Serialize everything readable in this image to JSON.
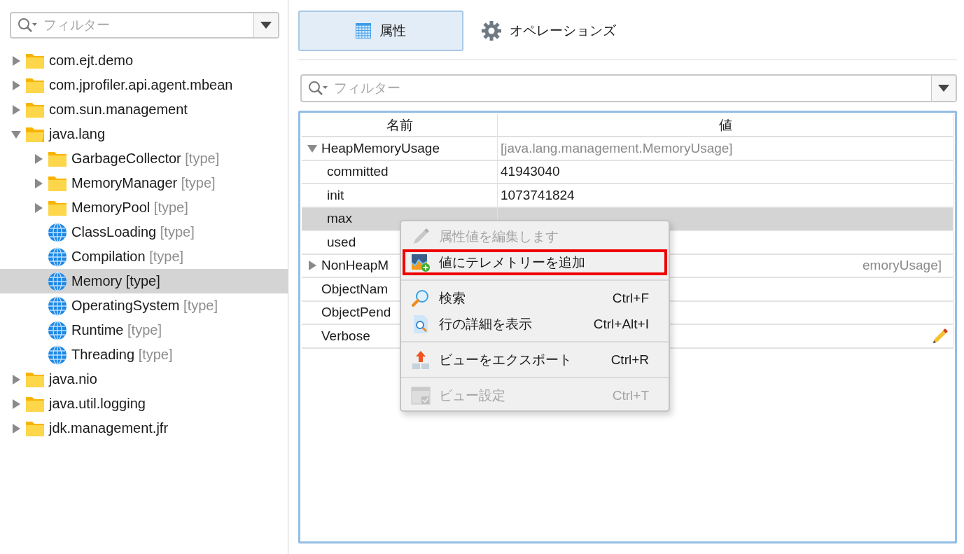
{
  "sidebar": {
    "filter": {
      "placeholder": "フィルター"
    },
    "tree": [
      {
        "label": "com.ejt.demo",
        "kind": "folder",
        "expanded": false,
        "selected": false
      },
      {
        "label": "com.jprofiler.api.agent.mbean",
        "kind": "folder",
        "expanded": false,
        "selected": false
      },
      {
        "label": "com.sun.management",
        "kind": "folder",
        "expanded": false,
        "selected": false
      },
      {
        "label": "java.lang",
        "kind": "folder",
        "expanded": true,
        "selected": false,
        "children": [
          {
            "label": "GarbageCollector",
            "suffix": "[type]",
            "kind": "folder",
            "expanded": false,
            "selected": false
          },
          {
            "label": "MemoryManager",
            "suffix": "[type]",
            "kind": "folder",
            "expanded": false,
            "selected": false
          },
          {
            "label": "MemoryPool",
            "suffix": "[type]",
            "kind": "folder",
            "expanded": false,
            "selected": false
          },
          {
            "label": "ClassLoading",
            "suffix": "[type]",
            "kind": "globe",
            "selected": false
          },
          {
            "label": "Compilation",
            "suffix": "[type]",
            "kind": "globe",
            "selected": false
          },
          {
            "label": "Memory",
            "suffix": "[type]",
            "kind": "globe",
            "selected": true
          },
          {
            "label": "OperatingSystem",
            "suffix": "[type]",
            "kind": "globe",
            "selected": false
          },
          {
            "label": "Runtime",
            "suffix": "[type]",
            "kind": "globe",
            "selected": false
          },
          {
            "label": "Threading",
            "suffix": "[type]",
            "kind": "globe",
            "selected": false
          }
        ]
      },
      {
        "label": "java.nio",
        "kind": "folder",
        "expanded": false,
        "selected": false
      },
      {
        "label": "java.util.logging",
        "kind": "folder",
        "expanded": false,
        "selected": false
      },
      {
        "label": "jdk.management.jfr",
        "kind": "folder",
        "expanded": false,
        "selected": false
      }
    ]
  },
  "tabs": [
    {
      "label": "属性",
      "kind": "grid",
      "selected": true
    },
    {
      "label": "オペレーションズ",
      "kind": "gear",
      "selected": false
    }
  ],
  "filter": {
    "placeholder": "フィルター"
  },
  "table": {
    "columns": [
      "名前",
      "値"
    ],
    "rows": [
      {
        "name": "HeapMemoryUsage",
        "value": "[java.lang.management.MemoryUsage]",
        "dim": true,
        "expanded": true,
        "selected": false,
        "children": [
          {
            "name": "committed",
            "value": "41943040",
            "dim": false,
            "selected": false
          },
          {
            "name": "init",
            "value": "1073741824",
            "dim": false,
            "selected": false
          },
          {
            "name": "max",
            "dim": false,
            "selected": true
          },
          {
            "name": "used",
            "dim": false,
            "selected": false
          }
        ]
      },
      {
        "name": "NonHeapM",
        "value": "emoryUsage]",
        "dim": true,
        "expanded": false,
        "selected": false,
        "kind": "cut"
      },
      {
        "name": "ObjectNam",
        "dim": false,
        "selected": false
      },
      {
        "name": "ObjectPend",
        "dim": false,
        "selected": false
      },
      {
        "name": "Verbose",
        "dim": false,
        "selected": false,
        "editable": true
      }
    ]
  },
  "context_menu": {
    "sections": [
      [
        {
          "label": "属性値を編集します",
          "kind": "pencil",
          "disabled": true,
          "selected": false
        },
        {
          "label": "値にテレメトリーを追加",
          "kind": "chart-add",
          "disabled": false,
          "selected": true
        }
      ],
      [
        {
          "label": "検索",
          "shortcut": "Ctrl+F",
          "kind": "search",
          "disabled": false,
          "selected": false
        },
        {
          "label": "行の詳細を表示",
          "shortcut": "Ctrl+Alt+I",
          "kind": "doc-search",
          "disabled": false,
          "selected": false
        }
      ],
      [
        {
          "label": "ビューをエクスポート",
          "shortcut": "Ctrl+R",
          "kind": "export",
          "disabled": false,
          "selected": false
        }
      ],
      [
        {
          "label": "ビュー設定",
          "shortcut": "Ctrl+T",
          "kind": "view-settings",
          "disabled": true,
          "selected": false
        }
      ]
    ]
  }
}
